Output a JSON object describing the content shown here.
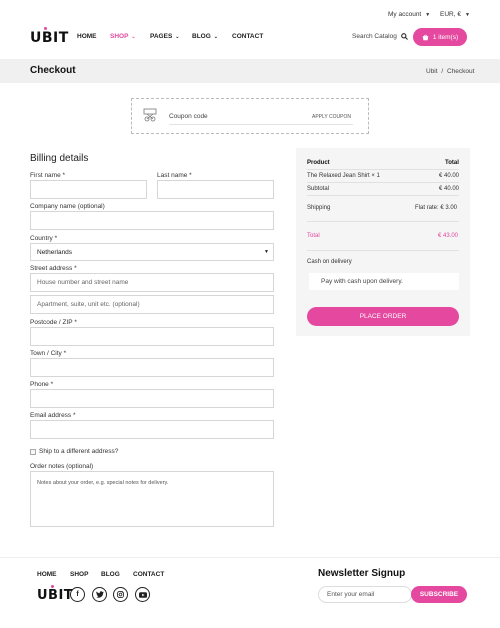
{
  "topbar": {
    "account": "My account",
    "currency": "EUR, €"
  },
  "brand": {
    "logo": "UBIT",
    "accent": "#e5489f"
  },
  "nav": {
    "home": "HOME",
    "shop": "SHOP",
    "pages": "PAGES",
    "blog": "BLOG",
    "contact": "CONTACT"
  },
  "search": {
    "label": "Search Catalog"
  },
  "cart": {
    "label": "1 item(s)"
  },
  "page": {
    "title": "Checkout"
  },
  "breadcrumb": {
    "home": "Ubit",
    "separator": "/",
    "current": "Checkout"
  },
  "coupon": {
    "label": "Coupon code",
    "button": "APPLY COUPON"
  },
  "billing": {
    "title": "Billing details",
    "first_name": "First name *",
    "last_name": "Last name *",
    "company": "Company name (optional)",
    "country": "Country *",
    "country_value": "Netherlands",
    "street": "Street address *",
    "street_placeholder": "House number and street name",
    "street2_placeholder": "Apartment, suite, unit etc. (optional)",
    "postcode": "Postcode / ZIP *",
    "city": "Town / City *",
    "phone": "Phone *",
    "email": "Email address *",
    "ship_different": "Ship to a different address?",
    "notes_label": "Order notes (optional)",
    "notes_placeholder": "Notes about your order, e.g. special notes for delivery."
  },
  "order": {
    "col_product": "Product",
    "col_total": "Total",
    "item_name": "The Relaxed Jean Shirt  × 1",
    "item_total": "€ 40.00",
    "subtotal_label": "Subtotal",
    "subtotal_value": "€ 40.00",
    "shipping_label": "Shipping",
    "shipping_value": "Flat rate: € 3.00",
    "total_label": "Total",
    "total_value": "€ 43.00",
    "payment_method": "Cash on delivery",
    "payment_desc": "Pay with cash upon delivery.",
    "place_order": "PLACE ORDER"
  },
  "footer": {
    "home": "HOME",
    "shop": "SHOP",
    "blog": "BLOG",
    "contact": "CONTACT",
    "logo": "UBIT",
    "newsletter_title": "Newsletter Signup",
    "email_placeholder": "Enter your email",
    "subscribe": "SUBSCRIBE"
  },
  "icons": {
    "facebook": "f",
    "twitter": "twitter-icon",
    "instagram": "instagram-icon",
    "youtube": "youtube-icon"
  }
}
